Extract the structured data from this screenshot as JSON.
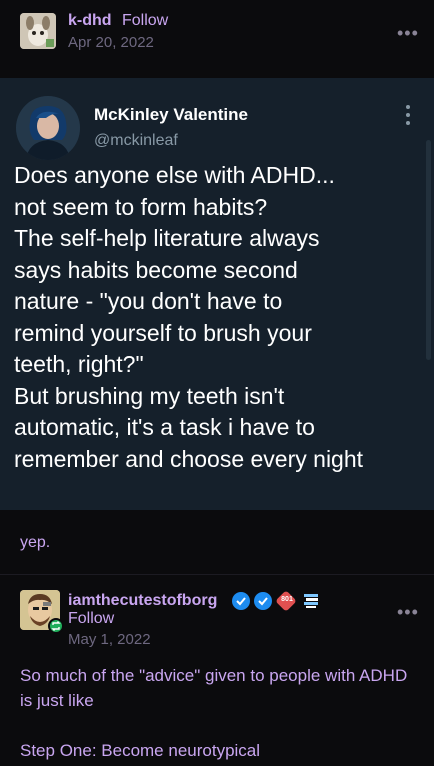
{
  "post": {
    "author": "k-dhd",
    "follow_label": "Follow",
    "date": "Apr 20, 2022",
    "more": "•••"
  },
  "tweet": {
    "name": "McKinley Valentine",
    "handle": "@mckinleaf",
    "more": "⋮",
    "lines": [
      "Does anyone else with ADHD...",
      "not seem to form habits?",
      "The self-help literature always",
      "says habits become second",
      "nature - \"you don't have to",
      "remind yourself to brush your",
      "teeth, right?\"",
      "But brushing my teeth isn't",
      "automatic, it's a task i have to",
      "remember and choose every night"
    ]
  },
  "reblog_comment": "yep.",
  "reblog": {
    "author": "iamthecutestofborg",
    "follow_label": "Follow",
    "date": "May 1, 2022",
    "more": "•••",
    "badge_text": "801",
    "paragraphs": [
      "So much of the \"advice\" given to people with ADHD is just like",
      "Step One: Become neurotypical"
    ]
  },
  "colors": {
    "accent": "#c9a6f0",
    "tweet_bg": "#15202b",
    "page_bg": "#0b0b0d",
    "verified_blue": "#1d8cf0"
  }
}
